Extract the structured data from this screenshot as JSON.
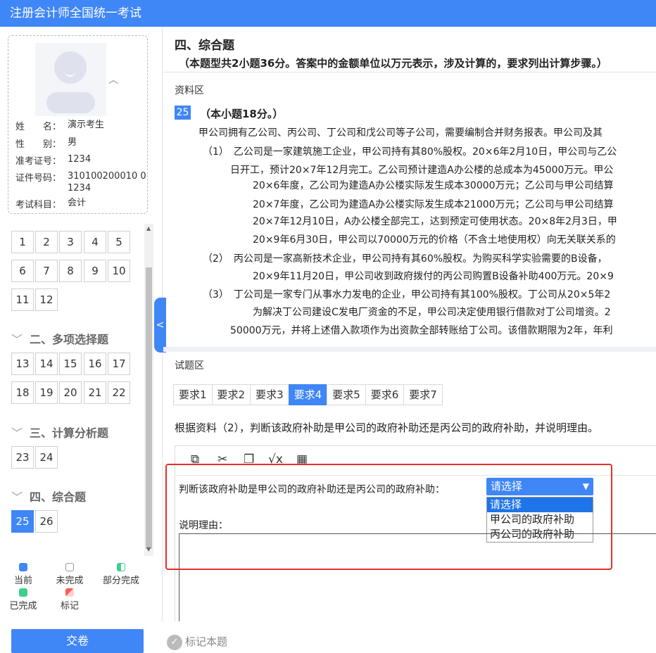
{
  "app": {
    "title": "注册会计师全国统一考试"
  },
  "candidate": {
    "fields": [
      {
        "label": "姓　　名：",
        "value": "演示考生"
      },
      {
        "label": "性　　别：",
        "value": "男"
      },
      {
        "label": "准考证号：",
        "value": "1234"
      },
      {
        "label": "证件号码：",
        "value": "310100200010 01234"
      },
      {
        "label": "考试科目：",
        "value": "会计"
      }
    ]
  },
  "nav": {
    "sections": [
      {
        "title": "二、多项选择题"
      },
      {
        "title": "三、计算分析题"
      },
      {
        "title": "四、综合题"
      }
    ],
    "numbers": [
      "1",
      "2",
      "3",
      "4",
      "5",
      "6",
      "7",
      "8",
      "9",
      "10",
      "11",
      "12",
      "13",
      "14",
      "15",
      "16",
      "17",
      "18",
      "19",
      "20",
      "21",
      "22",
      "23",
      "24",
      "25",
      "26"
    ]
  },
  "legend": {
    "current": "当前",
    "unfinished": "未完成",
    "partial": "部分完成",
    "done": "已完成",
    "marked": "标记"
  },
  "colors": {
    "accent": "#3f86f7",
    "done": "#3ecf8e",
    "marked": "#ff5a5a",
    "highlight": "#e62e2e"
  },
  "footer": {
    "submit": "交卷",
    "mark": "标记本题"
  },
  "main": {
    "section_title": "四、综合题",
    "section_note": "（本题型共2小题36分。答案中的金额单位以万元表示，涉及计算的，要求列出计算步骤。）",
    "material_label": "资料区",
    "question_no": "25",
    "question_score": "（本小题18分。）",
    "material_lines": [
      "甲公司拥有乙公司、丙公司、丁公司和戊公司等子公司，需要编制合并财务报表。甲公司及其",
      "（1）　乙公司是一家建筑施工企业，甲公司持有其80%股权。20×6年2月10日，甲公司与乙公",
      "日开工，预计20×7年12月完工。乙公司预计建造A办公楼的总成本为45000万元。甲公",
      "20×6年度，乙公司为建造A办公楼实际发生成本30000万元；乙公司与甲公司结算",
      "20×7年度，乙公司为建造A办公楼实际发生成本21000万元；乙公司与甲公司结算",
      "20×7年12月10日，A办公楼全部完工，达到预定可使用状态。20×8年2月3日，甲",
      "20×9年6月30日，甲公司以70000万元的价格（不含土地使用权）向无关联关系的",
      "（2）　丙公司是一家高新技术企业，甲公司持有其60%股权。为购买科学实验需要的B设备，",
      "20×9年11月20日，甲公司收到政府拨付的丙公司购置B设备补助400万元。20×9",
      "（3）　丁公司是一家专门从事水力发电的企业，甲公司持有其100%股权。丁公司从20×5年2",
      "为解决丁公司建设C发电厂资金的不足，甲公司决定使用银行借款对丁公司增资。2",
      "50000万元，并将上述借入款项作为出资款全部转账给丁公司。该借款期限为2年，年利"
    ],
    "question_area_label": "试题区",
    "tabs": [
      "要求1",
      "要求2",
      "要求3",
      "要求4",
      "要求5",
      "要求6",
      "要求7"
    ],
    "question_text": "根据资料（2），判断该政府补助是甲公司的政府补助还是丙公司的政府补助，并说明理由。",
    "answer": {
      "judge_label": "判断该政府补助是甲公司的政府补助还是丙公司的政府补助：",
      "select_value": "请选择",
      "options": [
        "请选择",
        "甲公司的政府补助",
        "丙公司的政府补助"
      ],
      "reason_label": "说明理由："
    },
    "toolbar_icons": [
      "copy-icon",
      "cut-icon",
      "paste-icon",
      "formula-icon",
      "table-icon"
    ]
  }
}
